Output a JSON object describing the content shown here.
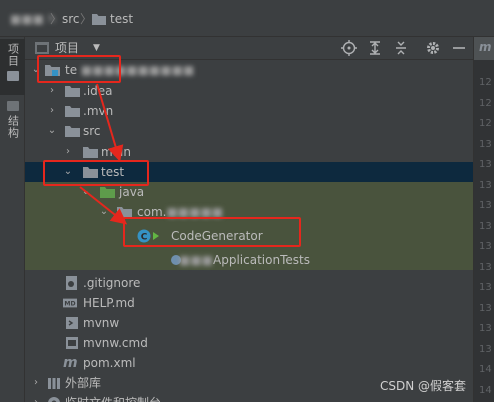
{
  "breadcrumb": {
    "first": "h",
    "items": [
      "src",
      "test"
    ]
  },
  "side_tabs": {
    "project": "项目",
    "structure": "结构"
  },
  "panel": {
    "title": "项目"
  },
  "tree": {
    "root": "te",
    "idea": ".idea",
    "mvn": ".mvn",
    "src": "src",
    "main": "main",
    "test": "test",
    "java": "java",
    "com": "com.",
    "codegen": "CodeGenerator",
    "apptests": "ApplicationTests",
    "gitignore": ".gitignore",
    "help": "HELP.md",
    "mvnw": "mvnw",
    "mvnwcmd": "mvnw.cmd",
    "pom": "pom.xml",
    "ext_libs": "外部库",
    "scratches": "临时文件和控制台"
  },
  "editor": {
    "line_numbers": [
      "12",
      "12",
      "12",
      "13",
      "13",
      "13",
      "13",
      "13",
      "13",
      "13",
      "13",
      "13",
      "13",
      "13",
      "14",
      "14"
    ]
  },
  "watermark": "CSDN @假客套",
  "colors": {
    "highlight": "#e5271d",
    "selected_row": "#0d293e",
    "test_bg": "#49533d",
    "folder": "#8a9199"
  }
}
